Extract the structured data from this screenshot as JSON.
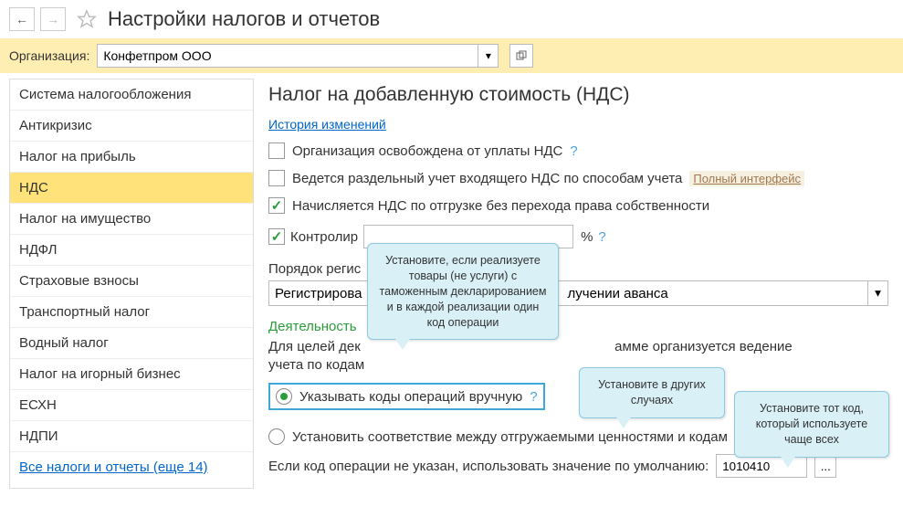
{
  "header": {
    "title": "Настройки налогов и отчетов"
  },
  "org": {
    "label": "Организация:",
    "value": "Конфетпром ООО"
  },
  "sidebar": {
    "items": [
      "Система налогообложения",
      "Антикризис",
      "Налог на прибыль",
      "НДС",
      "Налог на имущество",
      "НДФЛ",
      "Страховые взносы",
      "Транспортный налог",
      "Водный налог",
      "Налог на игорный бизнес",
      "ЕСХН",
      "НДПИ"
    ],
    "selected": 3,
    "all_link": "Все налоги и отчеты (еще 14)"
  },
  "content": {
    "title": "Налог на добавленную стоимость (НДС)",
    "history": "История изменений",
    "chk": {
      "exempt": "Организация освобождена от уплаты НДС",
      "split": "Ведется раздельный учет входящего НДС по способам учета",
      "ship": "Начисляется НДС по отгрузке без перехода права собственности",
      "control": "Контролир"
    },
    "badge": "Полный интерфейс",
    "pct": "%",
    "reg_label": "Порядок регис",
    "reg_value": "Регистрирова",
    "reg_suffix": "лучении аванса",
    "activity_head": "Деятельность",
    "activity_desc1": "Для целей дек",
    "activity_desc2": "амме организуется ведение",
    "activity_desc3": "учета по кодам",
    "radio1": "Указывать коды операций вручную",
    "radio2": "Установить соответствие между отгружаемыми ценностями и кодам",
    "default_label": "Если код операции не указан, использовать значение по умолчанию:",
    "default_value": "1010410"
  },
  "callouts": {
    "c1": "Установите, если реализуете товары (не услуги) с таможенным декларированием и в каждой реализации один код операции",
    "c2": "Установите в других случаях",
    "c3": "Установите тот код, который используете чаще всех"
  }
}
